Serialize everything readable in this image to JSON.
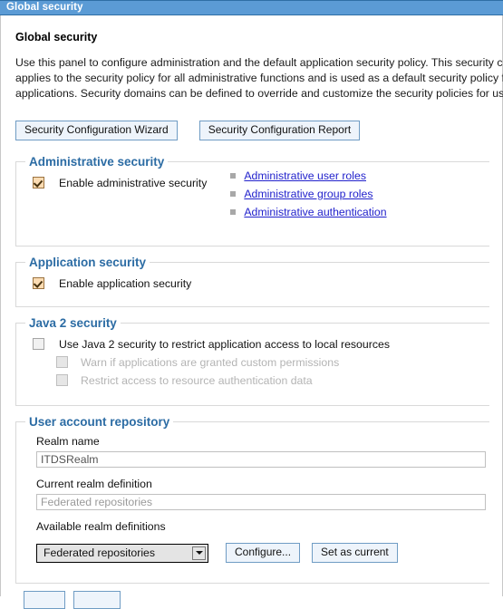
{
  "window": {
    "title": "Global security"
  },
  "page": {
    "heading": "Global security",
    "description": "Use this panel to configure administration and the default application security policy. This security configuration applies to the security policy for all administrative functions and is used as a default security policy for user applications. Security domains can be defined to override and customize the security policies for user applications."
  },
  "toolbar": {
    "wizard_button": "Security Configuration Wizard",
    "report_button": "Security Configuration Report"
  },
  "administrative_security": {
    "legend": "Administrative security",
    "checkbox_label": "Enable administrative security",
    "checkbox_checked": true,
    "links": [
      {
        "label": "Administrative user roles"
      },
      {
        "label": "Administrative group roles"
      },
      {
        "label": "Administrative authentication"
      }
    ]
  },
  "application_security": {
    "legend": "Application security",
    "checkbox_label": "Enable application security",
    "checkbox_checked": true
  },
  "java2_security": {
    "legend": "Java 2 security",
    "main_checkbox_label": "Use Java 2 security to restrict application access to local resources",
    "main_checkbox_checked": false,
    "sub_options": [
      {
        "label": "Warn if applications are granted custom permissions",
        "checked": false,
        "disabled": true
      },
      {
        "label": "Restrict access to resource authentication data",
        "checked": false,
        "disabled": true
      }
    ]
  },
  "user_account_repository": {
    "legend": "User account repository",
    "realm_name_label": "Realm name",
    "realm_name_value": "ITDSRealm",
    "current_realm_label": "Current realm definition",
    "current_realm_value": "Federated repositories",
    "available_realms_label": "Available realm definitions",
    "available_realms_selected": "Federated repositories",
    "available_realms_options": [
      "Federated repositories"
    ],
    "configure_button": "Configure...",
    "set_as_current_button": "Set as current"
  },
  "colors": {
    "titlebar": "#5b9bd5",
    "legend": "#2c6ca4",
    "link": "#2222cc",
    "button_face": "#eef4fb",
    "button_border": "#6f9cc4",
    "checkbox_checked_fill": "#fbdcb3"
  }
}
